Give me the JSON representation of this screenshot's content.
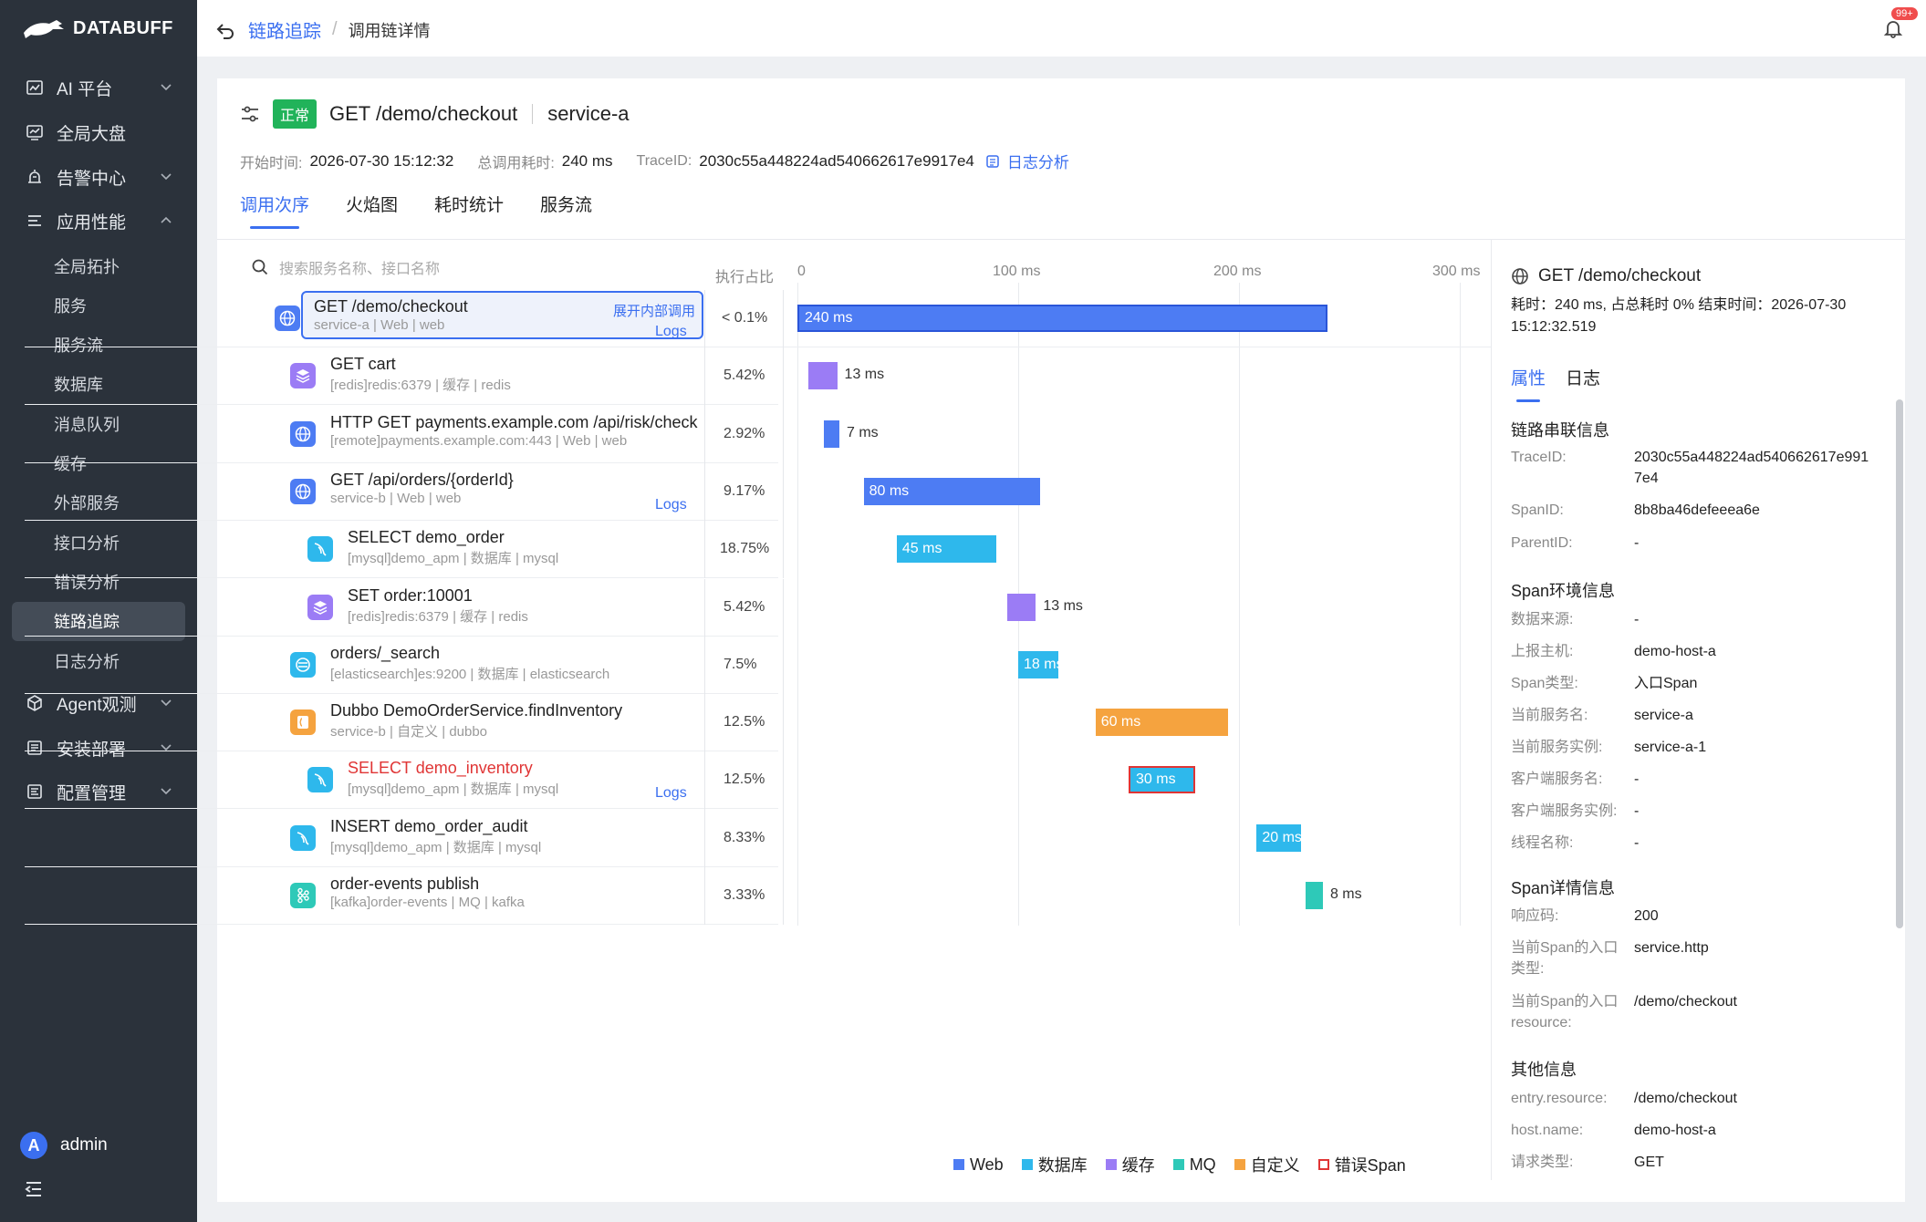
{
  "app": {
    "brand": "DATABUFF"
  },
  "sidebar": {
    "items": [
      {
        "label": "AI 平台",
        "icon": "ai-chart-icon",
        "chevron": true
      },
      {
        "label": "全局大盘",
        "icon": "dashboard-icon",
        "chevron": false
      },
      {
        "label": "告警中心",
        "icon": "alarm-icon",
        "chevron": true
      },
      {
        "label": "应用性能",
        "icon": "apm-icon",
        "chevron": true,
        "expanded": true
      }
    ],
    "sub_items": [
      {
        "label": "全局拓扑"
      },
      {
        "label": "服务"
      },
      {
        "label": "服务流"
      },
      {
        "label": "数据库"
      },
      {
        "label": "消息队列"
      },
      {
        "label": "缓存"
      },
      {
        "label": "外部服务"
      },
      {
        "label": "接口分析"
      },
      {
        "label": "错误分析"
      },
      {
        "label": "链路追踪",
        "active": true
      },
      {
        "label": "日志分析"
      }
    ],
    "bottom_items": [
      {
        "label": "Agent观测",
        "icon": "agent-cube-icon"
      },
      {
        "label": "安装部署",
        "icon": "install-icon"
      },
      {
        "label": "配置管理",
        "icon": "config-icon"
      }
    ],
    "user": {
      "avatar_letter": "A",
      "name": "admin"
    }
  },
  "header": {
    "breadcrumb_root": "链路追踪",
    "breadcrumb_sep": "/",
    "breadcrumb_current": "调用链详情",
    "notification_badge": "99+"
  },
  "trace": {
    "status": "正常",
    "operation": "GET /demo/checkout",
    "service": "service-a",
    "start_label": "开始时间:",
    "start_value": "2026-07-30 15:12:32",
    "duration_label": "总调用耗时:",
    "duration_value": "240 ms",
    "traceid_label": "TraceID:",
    "traceid_value": "2030c55a448224ad540662617e9917e4",
    "log_link": "日志分析"
  },
  "tabs": [
    {
      "label": "调用次序",
      "active": true
    },
    {
      "label": "火焰图"
    },
    {
      "label": "耗时统计"
    },
    {
      "label": "服务流"
    }
  ],
  "table": {
    "search_placeholder": "搜索服务名称、接口名称",
    "pct_header": "执行占比",
    "axis_ticks": [
      "0",
      "100 ms",
      "200 ms",
      "300 ms"
    ],
    "axis_max_ms": 300,
    "expand_label": "展开内部调用",
    "logs_label": "Logs",
    "rows": [
      {
        "name": "GET /demo/checkout",
        "sub": "service-a  |  Web  |  web",
        "pct": "< 0.1%",
        "type": "web",
        "icon": "globe-icon",
        "depth": 0,
        "start": 0,
        "dur": 240,
        "label": "240 ms",
        "logs": true,
        "selected": true
      },
      {
        "name": "GET cart",
        "sub": "[redis]redis:6379  |  缓存  |  redis",
        "pct": "5.42%",
        "type": "cache",
        "icon": "layers-icon",
        "depth": 1,
        "start": 5,
        "dur": 13,
        "label": "13 ms",
        "logs": false
      },
      {
        "name": "HTTP GET payments.example.com /api/risk/check",
        "sub": "[remote]payments.example.com:443  |  Web  |  web",
        "pct": "2.92%",
        "type": "web",
        "icon": "globe-icon",
        "depth": 1,
        "start": 12,
        "dur": 7,
        "label": "7 ms",
        "logs": false
      },
      {
        "name": "GET /api/orders/{orderId}",
        "sub": "service-b  |  Web  |  web",
        "pct": "9.17%",
        "type": "web",
        "icon": "globe-icon",
        "depth": 1,
        "start": 30,
        "dur": 80,
        "label": "80 ms",
        "logs": true
      },
      {
        "name": "SELECT demo_order",
        "sub": "[mysql]demo_apm  |  数据库  |  mysql",
        "pct": "18.75%",
        "type": "db",
        "icon": "mysql-dolphin-icon",
        "depth": 2,
        "start": 45,
        "dur": 45,
        "label": "45 ms",
        "logs": false
      },
      {
        "name": "SET order:10001",
        "sub": "[redis]redis:6379  |  缓存  |  redis",
        "pct": "5.42%",
        "type": "cache",
        "icon": "layers-icon",
        "depth": 2,
        "start": 95,
        "dur": 13,
        "label": "13 ms",
        "logs": false
      },
      {
        "name": "orders/_search",
        "sub": "[elasticsearch]es:9200  |  数据库  |  elasticsearch",
        "pct": "7.5%",
        "type": "db",
        "icon": "elasticsearch-icon",
        "depth": 1,
        "start": 100,
        "dur": 18,
        "label": "18 ms",
        "logs": false
      },
      {
        "name": "Dubbo DemoOrderService.findInventory",
        "sub": "service-b  |  自定义  |  dubbo",
        "pct": "12.5%",
        "type": "custom",
        "icon": "bracket-icon",
        "depth": 1,
        "start": 135,
        "dur": 60,
        "label": "60 ms",
        "logs": false
      },
      {
        "name": "SELECT demo_inventory",
        "sub": "[mysql]demo_apm  |  数据库  |  mysql",
        "pct": "12.5%",
        "type": "db",
        "icon": "mysql-dolphin-icon",
        "depth": 2,
        "start": 150,
        "dur": 30,
        "label": "30 ms",
        "logs": true,
        "error": true
      },
      {
        "name": "INSERT demo_order_audit",
        "sub": "[mysql]demo_apm  |  数据库  |  mysql",
        "pct": "8.33%",
        "type": "db",
        "icon": "mysql-dolphin-icon",
        "depth": 1,
        "start": 208,
        "dur": 20,
        "label": "20 ms",
        "logs": false
      },
      {
        "name": "order-events publish",
        "sub": "[kafka]order-events  |  MQ  |  kafka",
        "pct": "3.33%",
        "type": "mq",
        "icon": "kafka-icon",
        "depth": 1,
        "start": 230,
        "dur": 8,
        "label": "8 ms",
        "logs": false
      }
    ]
  },
  "colors": {
    "web": "#4d7cf3",
    "db": "#2eb8ec",
    "cache": "#9b7cf5",
    "mq": "#2ec9b8",
    "custom": "#f5a33f",
    "error": "#e03535",
    "accent": "#3b6ff0",
    "ok": "#21b35a"
  },
  "legend": [
    {
      "label": "Web",
      "type": "web"
    },
    {
      "label": "数据库",
      "type": "db"
    },
    {
      "label": "缓存",
      "type": "cache"
    },
    {
      "label": "MQ",
      "type": "mq"
    },
    {
      "label": "自定义",
      "type": "custom"
    },
    {
      "label": "错误Span",
      "type": "error"
    }
  ],
  "detail": {
    "title": "GET /demo/checkout",
    "summary": "耗时：240 ms, 占总耗时 0%  结束时间：2026-07-30 15:12:32.519",
    "tabs": [
      {
        "label": "属性",
        "active": true
      },
      {
        "label": "日志"
      }
    ],
    "sections": [
      {
        "title": "链路串联信息",
        "fields": [
          {
            "k": "TraceID:",
            "v": "2030c55a448224ad540662617e9917e4"
          },
          {
            "k": "SpanID:",
            "v": "8b8ba46defeeea6e"
          },
          {
            "k": "ParentID:",
            "v": "-"
          }
        ]
      },
      {
        "title": "Span环境信息",
        "fields": [
          {
            "k": "数据来源:",
            "v": "-"
          },
          {
            "k": "上报主机:",
            "v": "demo-host-a"
          },
          {
            "k": "Span类型:",
            "v": "入口Span"
          },
          {
            "k": "当前服务名:",
            "v": "service-a"
          },
          {
            "k": "当前服务实例:",
            "v": "service-a-1"
          },
          {
            "k": "客户端服务名:",
            "v": "-"
          },
          {
            "k": "客户端服务实例:",
            "v": "-"
          },
          {
            "k": "线程名称:",
            "v": "-"
          }
        ]
      },
      {
        "title": "Span详情信息",
        "fields": [
          {
            "k": "响应码:",
            "v": "200"
          },
          {
            "k": "当前Span的入口类型:",
            "v": "service.http"
          },
          {
            "k": "当前Span的入口resource:",
            "v": "/demo/checkout"
          }
        ]
      },
      {
        "title": "其他信息",
        "fields": [
          {
            "k": "entry.resource:",
            "v": "/demo/checkout"
          },
          {
            "k": "host.name:",
            "v": "demo-host-a"
          },
          {
            "k": "请求类型:",
            "v": "GET"
          }
        ]
      }
    ]
  }
}
